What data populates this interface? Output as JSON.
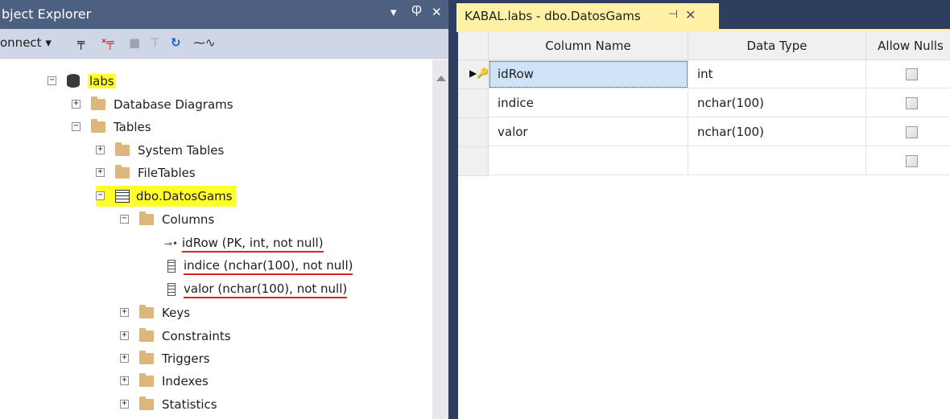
{
  "object_explorer": {
    "title": "bject Explorer",
    "dropdown_glyph": "▾",
    "pin_glyph": "Ⴔ",
    "close_glyph": "✕",
    "toolbar": {
      "connect_label": "onnect ▾",
      "icons": [
        "connect-plug-icon",
        "disconnect-plug-icon",
        "stop-icon",
        "filter-icon",
        "refresh-icon",
        "activity-monitor-icon"
      ],
      "icon_glyphs": [
        "╤",
        "ˣ╤",
        "■",
        "⊤",
        "↻",
        "⁓∿"
      ]
    },
    "tree": [
      {
        "label": "labs",
        "expander": "−",
        "icon": "database-icon",
        "highlight": true
      },
      {
        "label": "Database Diagrams",
        "expander": "+",
        "icon": "folder-icon"
      },
      {
        "label": "Tables",
        "expander": "−",
        "icon": "folder-icon"
      },
      {
        "label": "System Tables",
        "expander": "+",
        "icon": "folder-icon"
      },
      {
        "label": "FileTables",
        "expander": "+",
        "icon": "folder-icon"
      },
      {
        "label": "dbo.DatosGams",
        "expander": "−",
        "icon": "table-icon",
        "highlight": true
      },
      {
        "label": "Columns",
        "expander": "−",
        "icon": "folder-icon"
      },
      {
        "label": "idRow (PK, int, not null)",
        "icon": "primary-key-icon",
        "key_glyph": "⊸•",
        "underline": true
      },
      {
        "label": "indice (nchar(100), not null)",
        "icon": "column-icon",
        "underline": true
      },
      {
        "label": "valor (nchar(100), not null)",
        "icon": "column-icon",
        "underline": true
      },
      {
        "label": "Keys",
        "expander": "+",
        "icon": "folder-icon"
      },
      {
        "label": "Constraints",
        "expander": "+",
        "icon": "folder-icon"
      },
      {
        "label": "Triggers",
        "expander": "+",
        "icon": "folder-icon"
      },
      {
        "label": "Indexes",
        "expander": "+",
        "icon": "folder-icon"
      },
      {
        "label": "Statistics",
        "expander": "+",
        "icon": "folder-icon"
      }
    ]
  },
  "document_tab": {
    "title": "KABAL.labs - dbo.DatosGams",
    "pin_glyph": "⊣",
    "close_glyph": "✕"
  },
  "table_designer": {
    "headers": [
      "Column Name",
      "Data Type",
      "Allow Nulls"
    ],
    "current_row_marker": "▶",
    "key_glyph": "🔑",
    "rows": [
      {
        "column_name": "idRow",
        "data_type": "int",
        "allow_nulls": false,
        "primary_key": true,
        "current": true
      },
      {
        "column_name": "indice",
        "data_type": "nchar(100)",
        "allow_nulls": false
      },
      {
        "column_name": "valor",
        "data_type": "nchar(100)",
        "allow_nulls": false
      },
      {
        "column_name": "",
        "data_type": "",
        "allow_nulls": false
      }
    ]
  },
  "colors": {
    "title_bar": "#4d6082",
    "toolbar": "#cfd6e5",
    "highlight": "#ffff2a",
    "underline": "#e0201a",
    "active_tab": "#fff1a5",
    "selected_cell": "#cfe3f6",
    "background": "#2d3e5f"
  }
}
